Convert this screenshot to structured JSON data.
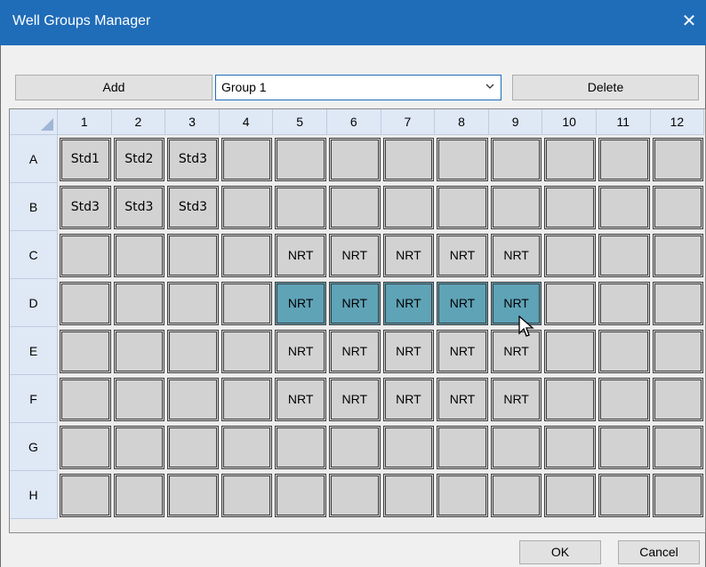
{
  "window": {
    "title": "Well Groups Manager",
    "close_glyph": "✕"
  },
  "toolbar": {
    "add_label": "Add",
    "group_selected": "Group 1",
    "delete_label": "Delete"
  },
  "footer": {
    "ok_label": "OK",
    "cancel_label": "Cancel"
  },
  "plate": {
    "columns": [
      "1",
      "2",
      "3",
      "4",
      "5",
      "6",
      "7",
      "8",
      "9",
      "10",
      "11",
      "12"
    ],
    "rows": [
      {
        "label": "A",
        "cells": [
          "Std1",
          "Std2",
          "Std3",
          "",
          "",
          "",
          "",
          "",
          "",
          "",
          "",
          ""
        ],
        "selected": []
      },
      {
        "label": "B",
        "cells": [
          "Std3",
          "Std3",
          "Std3",
          "",
          "",
          "",
          "",
          "",
          "",
          "",
          "",
          ""
        ],
        "selected": []
      },
      {
        "label": "C",
        "cells": [
          "",
          "",
          "",
          "",
          "NRT",
          "NRT",
          "NRT",
          "NRT",
          "NRT",
          "",
          "",
          ""
        ],
        "selected": []
      },
      {
        "label": "D",
        "cells": [
          "",
          "",
          "",
          "",
          "NRT",
          "NRT",
          "NRT",
          "NRT",
          "NRT",
          "",
          "",
          ""
        ],
        "selected": [
          5,
          6,
          7,
          8,
          9
        ]
      },
      {
        "label": "E",
        "cells": [
          "",
          "",
          "",
          "",
          "NRT",
          "NRT",
          "NRT",
          "NRT",
          "NRT",
          "",
          "",
          ""
        ],
        "selected": []
      },
      {
        "label": "F",
        "cells": [
          "",
          "",
          "",
          "",
          "NRT",
          "NRT",
          "NRT",
          "NRT",
          "NRT",
          "",
          "",
          ""
        ],
        "selected": []
      },
      {
        "label": "G",
        "cells": [
          "",
          "",
          "",
          "",
          "",
          "",
          "",
          "",
          "",
          "",
          "",
          ""
        ],
        "selected": []
      },
      {
        "label": "H",
        "cells": [
          "",
          "",
          "",
          "",
          "",
          "",
          "",
          "",
          "",
          "",
          "",
          ""
        ],
        "selected": []
      }
    ]
  },
  "colors": {
    "titlebar": "#1f6cb8",
    "selected_well": "#5fa3b7",
    "well": "#d2d2d2",
    "header": "#dfe8f5"
  },
  "icons": {
    "dropdown": "chevron-down-icon",
    "cursor": "mouse-pointer-icon"
  }
}
